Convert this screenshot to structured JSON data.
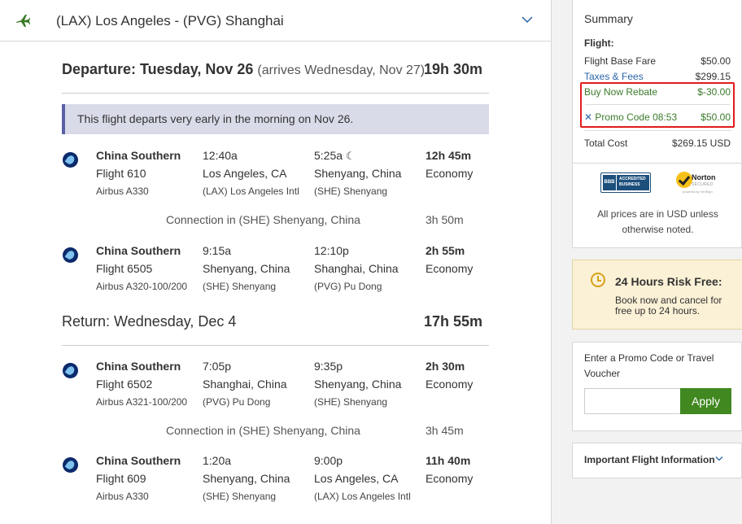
{
  "route": {
    "title": "(LAX) Los Angeles - (PVG) Shanghai"
  },
  "departure": {
    "label": "Departure: Tuesday, Nov 26",
    "arrives": "(arrives Wednesday, Nov 27)",
    "duration": "19h 30m",
    "notice": "This flight departs very early in the morning on Nov 26.",
    "segments": [
      {
        "airline": "China Southern",
        "flight": "Flight 610",
        "aircraft": "Airbus A330",
        "dep_time": "12:40a",
        "dep_city": "Los Angeles, CA",
        "dep_airport": "(LAX) Los Angeles Intl",
        "arr_time": "5:25a",
        "arr_city": "Shenyang, China",
        "arr_airport": "(SHE) Shenyang",
        "duration": "12h 45m",
        "cabin": "Economy"
      },
      {
        "airline": "China Southern",
        "flight": "Flight 6505",
        "aircraft": "Airbus A320-100/200",
        "dep_time": "9:15a",
        "dep_city": "Shenyang, China",
        "dep_airport": "(SHE) Shenyang",
        "arr_time": "12:10p",
        "arr_city": "Shanghai, China",
        "arr_airport": "(PVG) Pu Dong",
        "duration": "2h 55m",
        "cabin": "Economy"
      }
    ],
    "connection": {
      "text": "Connection in (SHE) Shenyang, China",
      "duration": "3h 50m"
    }
  },
  "return": {
    "label": "Return: Wednesday, Dec 4",
    "duration": "17h 55m",
    "segments": [
      {
        "airline": "China Southern",
        "flight": "Flight 6502",
        "aircraft": "Airbus A321-100/200",
        "dep_time": "7:05p",
        "dep_city": "Shanghai, China",
        "dep_airport": "(PVG) Pu Dong",
        "arr_time": "9:35p",
        "arr_city": "Shenyang, China",
        "arr_airport": "(SHE) Shenyang",
        "duration": "2h 30m",
        "cabin": "Economy"
      },
      {
        "airline": "China Southern",
        "flight": "Flight 609",
        "aircraft": "Airbus A330",
        "dep_time": "1:20a",
        "dep_city": "Shenyang, China",
        "dep_airport": "(SHE) Shenyang",
        "arr_time": "9:00p",
        "arr_city": "Los Angeles, CA",
        "arr_airport": "(LAX) Los Angeles Intl",
        "duration": "11h 40m",
        "cabin": "Economy"
      }
    ],
    "connection": {
      "text": "Connection in (SHE) Shenyang, China",
      "duration": "3h 45m"
    }
  },
  "summary": {
    "title": "Summary",
    "flight_label": "Flight:",
    "base_fare_label": "Flight Base Fare",
    "base_fare": "$50.00",
    "taxes_label": "Taxes & Fees",
    "taxes": "$299.15",
    "rebate_label": "Buy Now Rebate",
    "rebate": "$-30.00",
    "promo_label": "Promo Code 08:53",
    "promo": "$50.00",
    "total_label": "Total Cost",
    "total": "$269.15 USD",
    "bbb_left": "BBB",
    "bbb_right": "ACCREDITED BUSINESS",
    "norton_name": "Norton",
    "norton_sub": "SECURED",
    "norton_by": "powered by VeriSign",
    "usd_note": "All prices are in USD unless otherwise noted."
  },
  "risk_free": {
    "title": "24 Hours Risk Free:",
    "text": "Book now and cancel for free up to 24 hours."
  },
  "promo_box": {
    "label": "Enter a Promo Code or Travel Voucher",
    "placeholder": "",
    "button": "Apply"
  },
  "important": {
    "label": "Important Flight Information"
  },
  "colors": {
    "accent_green": "#418820",
    "link_blue": "#2a64a6",
    "highlight_red": "#e21b1b",
    "notice_bar": "#5a5fa6"
  }
}
